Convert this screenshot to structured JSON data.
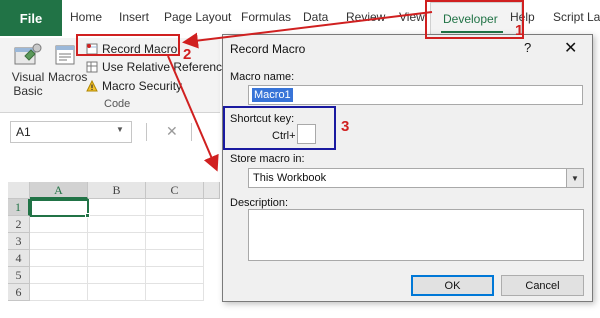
{
  "ribbon_tabs": {
    "file": "File",
    "home": "Home",
    "insert": "Insert",
    "page_layout": "Page Layout",
    "formulas": "Formulas",
    "data": "Data",
    "review": "Review",
    "view": "View",
    "developer": "Developer",
    "help": "Help",
    "script_lab": "Script La"
  },
  "code_group": {
    "visual_basic_line1": "Visual",
    "visual_basic_line2": "Basic",
    "macros": "Macros",
    "record_macro": "Record Macro",
    "use_relative": "Use Relative References",
    "macro_security": "Macro Security",
    "group_label": "Code"
  },
  "formula_bar": {
    "name_box": "A1"
  },
  "grid": {
    "columns": [
      "A",
      "B",
      "C"
    ],
    "rows": [
      "1",
      "2",
      "3",
      "4",
      "5",
      "6"
    ]
  },
  "annotations": {
    "step1": "1",
    "step2": "2",
    "step3": "3"
  },
  "dialog": {
    "title": "Record Macro",
    "help": "?",
    "close": "✕",
    "macro_name_label": "Macro name:",
    "macro_name_value": "Macro1",
    "shortcut_label": "Shortcut key:",
    "ctrl_label": "Ctrl+",
    "store_label": "Store macro in:",
    "store_value": "This Workbook",
    "description_label": "Description:",
    "ok": "OK",
    "cancel": "Cancel"
  },
  "colors": {
    "excel_green": "#217346",
    "annotation_red": "#d02020",
    "annotation_blue": "#1a1aa0"
  }
}
